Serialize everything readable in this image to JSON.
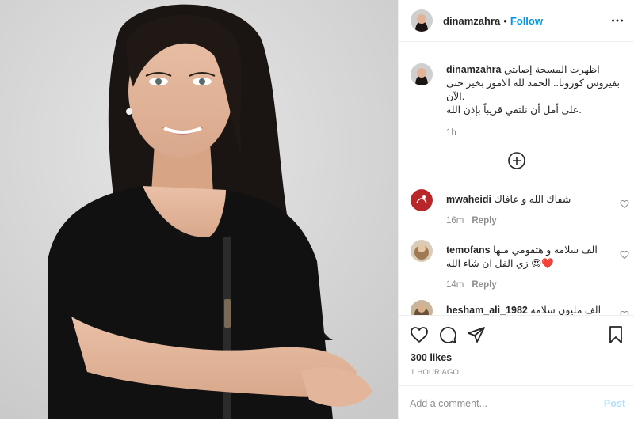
{
  "post": {
    "username": "dinamzahra",
    "separator": "•",
    "follow_label": "Follow"
  },
  "caption": {
    "username": "dinamzahra",
    "text": "اظهرت المسحة إصابتي بفيروس كورونا.. الحمد لله الامور بخير حتى الآن.\nعلى أمل أن نلتقي قريباً بإذن الله.",
    "time": "1h"
  },
  "comments": [
    {
      "username": "mwaheidi",
      "text": "شفاك الله و عافاك",
      "time": "16m",
      "reply_label": "Reply"
    },
    {
      "username": "temofans",
      "text": "الف سلامه و هتقومي منها زي الفل ان شاء الله 😍❤️",
      "time": "14m",
      "reply_label": "Reply"
    },
    {
      "username": "hesham_ali_1982",
      "text": "الف مليون سلامه",
      "time": "",
      "reply_label": ""
    }
  ],
  "icons": {
    "more": "more-options-icon",
    "load_more": "plus-circle-icon",
    "like": "heart-icon",
    "comment": "comment-icon",
    "share": "paper-plane-icon",
    "save": "bookmark-icon",
    "comment_like": "small-heart-icon"
  },
  "stats": {
    "likes": "300 likes",
    "posted": "1 HOUR AGO"
  },
  "add_comment": {
    "placeholder": "Add a comment...",
    "post_label": "Post"
  },
  "colors": {
    "accent": "#0095f6",
    "post_disabled": "#b2dffc",
    "muted": "#8e8e8e"
  }
}
